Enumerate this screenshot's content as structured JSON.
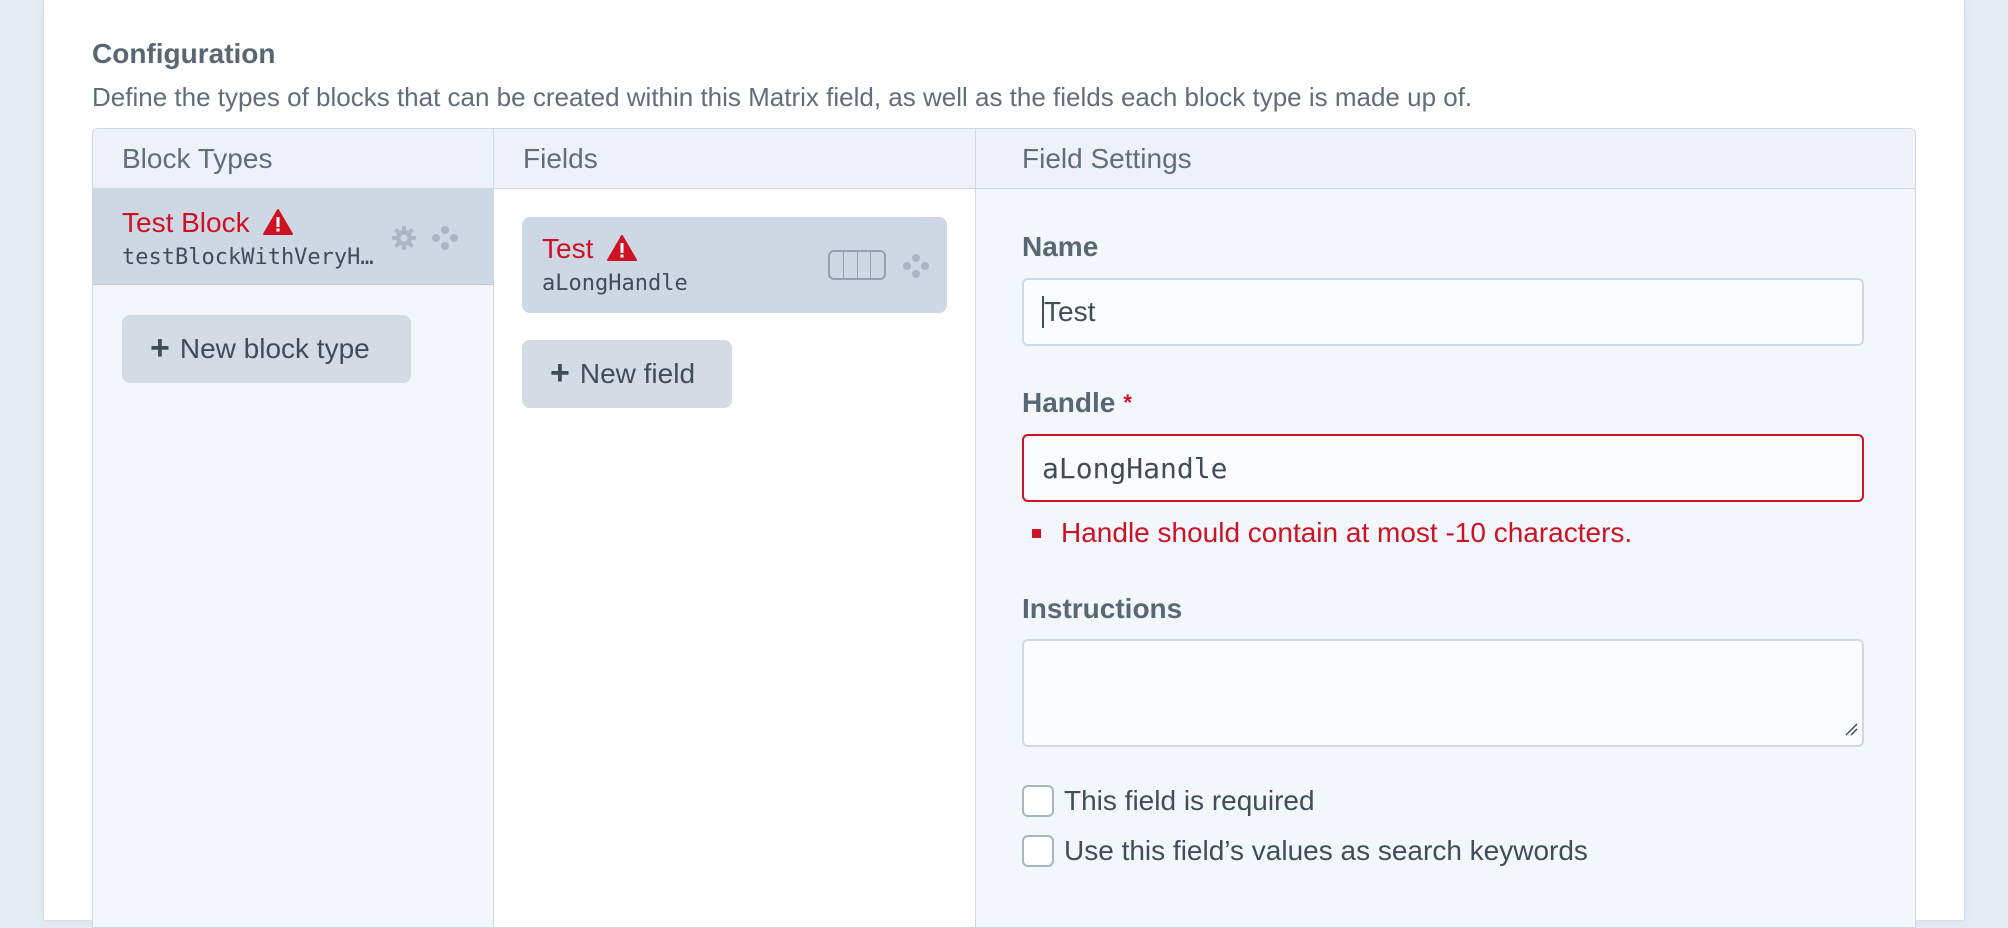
{
  "config": {
    "title": "Configuration",
    "description": "Define the types of blocks that can be created within this Matrix field, as well as the fields each block type is made up of."
  },
  "columns": {
    "block_types": "Block Types",
    "fields": "Fields",
    "field_settings": "Field Settings"
  },
  "block_types": {
    "items": [
      {
        "name": "Test Block",
        "handle": "testBlockWithVeryH…",
        "has_error": true
      }
    ],
    "new_button": "New block type"
  },
  "fields": {
    "items": [
      {
        "name": "Test",
        "handle": "aLongHandle",
        "has_error": true
      }
    ],
    "new_button": "New field"
  },
  "settings": {
    "name_label": "Name",
    "name_value": "Test",
    "handle_label": "Handle",
    "handle_required_mark": "*",
    "handle_value": "aLongHandle",
    "handle_error": "Handle should contain at most -10 characters.",
    "instructions_label": "Instructions",
    "instructions_value": "",
    "required_checkbox": {
      "label": "This field is required",
      "checked": false
    },
    "search_checkbox": {
      "label": "Use this field’s values as search keywords",
      "checked": false
    }
  },
  "colors": {
    "error": "#cf1124",
    "selected_item_bg": "#cdd8e4",
    "button_bg": "#d4dbe4",
    "page_bg": "#e4ecf6"
  },
  "icons": [
    "warning-icon",
    "gear-icon",
    "move-icon",
    "plus-icon",
    "field-width-icon",
    "resize-handle-icon",
    "asterisk-icon"
  ]
}
